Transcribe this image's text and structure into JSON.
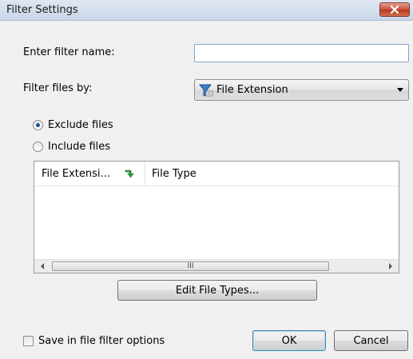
{
  "window": {
    "title": "Filter Settings",
    "close_icon": "close-x-icon"
  },
  "form": {
    "filter_name_label": "Enter filter name:",
    "filter_name_value": "",
    "filter_by_label": "Filter files by:",
    "filter_by_selected": "File Extension",
    "filter_by_icon": "funnel-icon"
  },
  "radios": {
    "exclude_label": "Exclude files",
    "include_label": "Include files",
    "selected": "exclude"
  },
  "list": {
    "columns": [
      "File Extensi...",
      "File Type"
    ],
    "sort_icon": "green-sort-arrow-icon",
    "rows": [],
    "scroll_grip": "III"
  },
  "buttons": {
    "edit_file_types": "Edit File Types...",
    "ok": "OK",
    "cancel": "Cancel"
  },
  "options": {
    "save_in_filter_options_label": "Save in file filter options",
    "save_in_filter_options_checked": false
  },
  "colors": {
    "accent_blue": "#1c4f9c",
    "close_red": "#c7503d",
    "sort_green": "#2f9e3a"
  }
}
